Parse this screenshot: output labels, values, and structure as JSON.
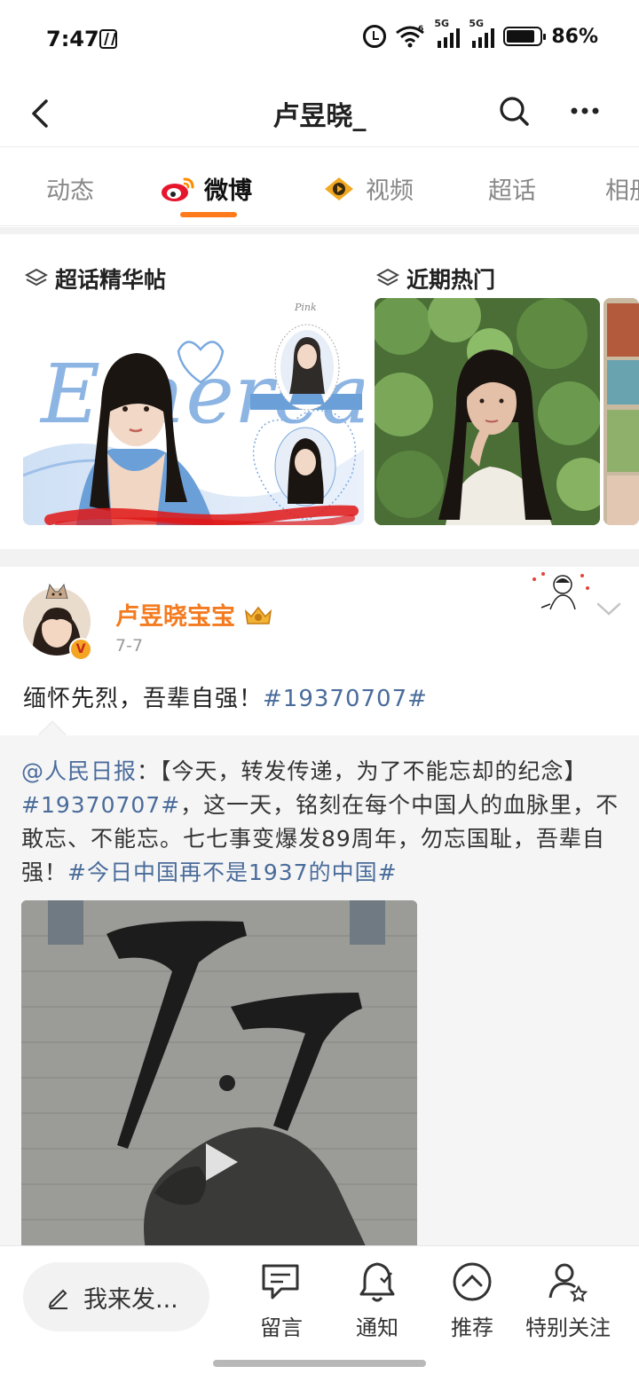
{
  "status": {
    "time": "7:47",
    "net1": "5G",
    "net2": "5G",
    "wifi_badge": "6",
    "battery_pct": "86%",
    "battery_level": 0.86
  },
  "header": {
    "title": "卢昱晓_"
  },
  "tabs": [
    {
      "label": "动态",
      "active": false
    },
    {
      "label": "微博",
      "active": true
    },
    {
      "label": "视频",
      "active": false
    },
    {
      "label": "超话",
      "active": false
    },
    {
      "label": "相册",
      "active": false
    }
  ],
  "featured": {
    "section1_title": "超话精华帖",
    "section2_title": "近期热门",
    "card1_art_text": "Ethereal",
    "card1_small_text": "Pink"
  },
  "post": {
    "user": "卢昱晓宝宝",
    "badge": "V",
    "date": "7-7",
    "text": "缅怀先烈，吾辈自强！",
    "hashtag": "#19370707#"
  },
  "repost": {
    "mention": "@人民日报",
    "part1": "：【今天，转发传递，为了不能忘却的纪念】",
    "hashtag1": "#19370707#",
    "part2": "，这一天，铭刻在每个中国人的血脉里，不敢忘、不能忘。七七事变爆发89周年，勿忘国耻，吾辈自强！",
    "hashtag2": "#今日中国再不是1937的中国#"
  },
  "bottom_bar": {
    "compose_label": "我来发...",
    "items": [
      {
        "label": "留言",
        "icon": "comment-icon"
      },
      {
        "label": "通知",
        "icon": "bell-icon"
      },
      {
        "label": "推荐",
        "icon": "chevron-up-circle-icon"
      },
      {
        "label": "特别关注",
        "icon": "user-star-icon"
      }
    ]
  },
  "colors": {
    "accent": "#ff7a1a",
    "username": "#f47b20",
    "hashtag": "#4a6c9b"
  }
}
